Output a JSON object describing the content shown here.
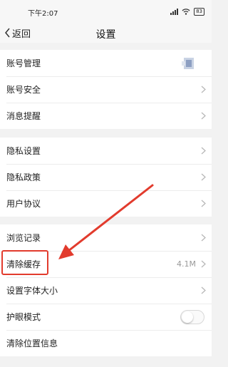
{
  "status": {
    "time": "下午2:07",
    "battery": "83"
  },
  "nav": {
    "back_label": "返回",
    "title": "设置"
  },
  "group1": [
    {
      "label": "账号管理"
    },
    {
      "label": "账号安全"
    },
    {
      "label": "消息提醒"
    }
  ],
  "group2": [
    {
      "label": "隐私设置"
    },
    {
      "label": "隐私政策"
    },
    {
      "label": "用户协议"
    }
  ],
  "group3": [
    {
      "label": "浏览记录"
    },
    {
      "label": "清除缓存",
      "value": "4.1M"
    },
    {
      "label": "设置字体大小"
    },
    {
      "label": "护眼模式",
      "toggle_on": false
    },
    {
      "label": "清除位置信息"
    }
  ],
  "colors": {
    "annotation_red": "#e23b2d",
    "background": "#f2f2f2",
    "chevron": "#b5b5b5"
  },
  "icons": [
    "signal-icon",
    "wifi-icon",
    "battery-icon",
    "back-chevron-icon",
    "chevron-right-icon",
    "avatar-thumbnail"
  ]
}
